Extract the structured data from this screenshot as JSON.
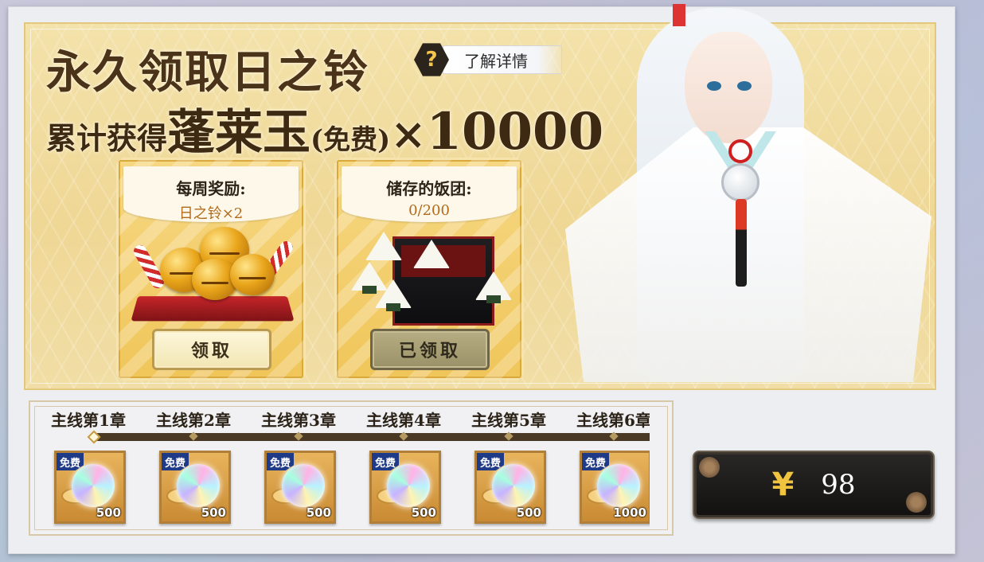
{
  "header": {
    "title_line1": "永久领取日之铃",
    "title_line2_a": "累计获得",
    "title_line2_b": "蓬莱玉",
    "title_line2_c": "(免费)",
    "title_line2_d": "×",
    "title_line2_e": "10000",
    "info_icon": "?",
    "info_label": "了解详情"
  },
  "cards": {
    "weekly": {
      "heading": "每周奖励:",
      "value": "日之铃×2",
      "button": "领取",
      "art": "golden-bells-icon"
    },
    "stored": {
      "heading": "储存的饭团:",
      "value": "0/200",
      "button": "已领取",
      "art": "onigiri-box-icon"
    }
  },
  "chapters": [
    {
      "label": "主线第1章",
      "tag": "免费",
      "amount": "500"
    },
    {
      "label": "主线第2章",
      "tag": "免费",
      "amount": "500"
    },
    {
      "label": "主线第3章",
      "tag": "免费",
      "amount": "500"
    },
    {
      "label": "主线第4章",
      "tag": "免费",
      "amount": "500"
    },
    {
      "label": "主线第5章",
      "tag": "免费",
      "amount": "500"
    },
    {
      "label": "主线第6章",
      "tag": "免费",
      "amount": "1000"
    }
  ],
  "purchase": {
    "currency_symbol": "¥",
    "price": "98"
  },
  "colors": {
    "banner_gold": "#efd795",
    "title_brown": "#4a3318",
    "accent_orange": "#b26b1a",
    "price_yen": "#f0c43e",
    "free_tag_blue": "#1f3a87"
  }
}
